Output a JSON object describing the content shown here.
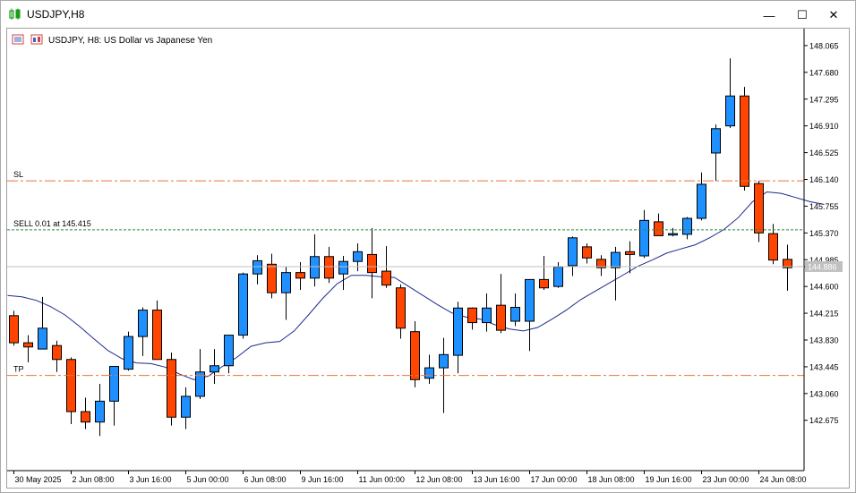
{
  "window": {
    "title": "USDJPY,H8"
  },
  "chart_header": {
    "text": "USDJPY, H8:  US Dollar vs Japanese Yen"
  },
  "window_buttons": {
    "minimize": "—",
    "maximize": "☐",
    "close": "✕"
  },
  "price_badge": "144.886",
  "trade_lines": {
    "sl": {
      "label": "SL",
      "price": 146.12,
      "color": "#e8743b"
    },
    "sell": {
      "label": "SELL 0.01 at 145.415",
      "price": 145.415,
      "color": "#2e8b3e"
    },
    "tp": {
      "label": "TP",
      "price": 143.32,
      "color": "#e8743b"
    }
  },
  "colors": {
    "bull": "#1e90ff",
    "bear": "#ff4500",
    "ma": "#1c2a8c",
    "bid_line": "#c0c0c0"
  },
  "chart_data": {
    "type": "candlestick",
    "symbol": "USDJPY",
    "timeframe": "H8",
    "ylim": [
      142.35,
      148.18
    ],
    "y_ticks": [
      "148.065",
      "147.680",
      "147.295",
      "146.910",
      "146.525",
      "146.140",
      "145.755",
      "145.370",
      "144.985",
      "144.600",
      "144.215",
      "143.830",
      "143.445",
      "143.060",
      "142.675"
    ],
    "x_ticks": [
      "30 May 2025",
      "2 Jun 08:00",
      "3 Jun 16:00",
      "5 Jun 00:00",
      "6 Jun 08:00",
      "9 Jun 16:00",
      "11 Jun 00:00",
      "12 Jun 08:00",
      "13 Jun 16:00",
      "17 Jun 00:00",
      "18 Jun 08:00",
      "19 Jun 16:00",
      "23 Jun 00:00",
      "24 Jun 08:00"
    ],
    "x_tick_index": [
      0,
      4,
      8,
      12,
      16,
      20,
      24,
      28,
      32,
      36,
      40,
      44,
      48,
      52
    ],
    "candles": [
      {
        "o": 144.18,
        "h": 144.25,
        "l": 143.75,
        "c": 143.79
      },
      {
        "o": 143.79,
        "h": 143.9,
        "l": 143.51,
        "c": 143.73
      },
      {
        "o": 143.7,
        "h": 144.45,
        "l": 143.7,
        "c": 144.0
      },
      {
        "o": 143.75,
        "h": 143.82,
        "l": 143.37,
        "c": 143.55
      },
      {
        "o": 143.55,
        "h": 143.58,
        "l": 142.62,
        "c": 142.8
      },
      {
        "o": 142.8,
        "h": 143.0,
        "l": 142.55,
        "c": 142.65
      },
      {
        "o": 142.65,
        "h": 143.2,
        "l": 142.45,
        "c": 142.95
      },
      {
        "o": 142.95,
        "h": 143.45,
        "l": 142.6,
        "c": 143.45
      },
      {
        "o": 143.41,
        "h": 143.95,
        "l": 143.39,
        "c": 143.88
      },
      {
        "o": 143.88,
        "h": 144.3,
        "l": 143.6,
        "c": 144.26
      },
      {
        "o": 144.26,
        "h": 144.4,
        "l": 143.64,
        "c": 143.55
      },
      {
        "o": 143.55,
        "h": 143.65,
        "l": 142.6,
        "c": 142.72
      },
      {
        "o": 142.72,
        "h": 143.15,
        "l": 142.55,
        "c": 143.02
      },
      {
        "o": 143.02,
        "h": 143.7,
        "l": 142.98,
        "c": 143.37
      },
      {
        "o": 143.37,
        "h": 143.7,
        "l": 143.2,
        "c": 143.46
      },
      {
        "o": 143.46,
        "h": 143.9,
        "l": 143.35,
        "c": 143.9
      },
      {
        "o": 143.9,
        "h": 144.8,
        "l": 143.85,
        "c": 144.78
      },
      {
        "o": 144.78,
        "h": 145.05,
        "l": 144.63,
        "c": 144.97
      },
      {
        "o": 144.92,
        "h": 145.07,
        "l": 144.43,
        "c": 144.51
      },
      {
        "o": 144.51,
        "h": 144.88,
        "l": 144.12,
        "c": 144.8
      },
      {
        "o": 144.8,
        "h": 144.95,
        "l": 144.55,
        "c": 144.72
      },
      {
        "o": 144.72,
        "h": 145.35,
        "l": 144.6,
        "c": 145.03
      },
      {
        "o": 145.03,
        "h": 145.17,
        "l": 144.65,
        "c": 144.72
      },
      {
        "o": 144.78,
        "h": 145.04,
        "l": 144.55,
        "c": 144.96
      },
      {
        "o": 144.96,
        "h": 145.22,
        "l": 144.82,
        "c": 145.1
      },
      {
        "o": 145.06,
        "h": 145.44,
        "l": 144.43,
        "c": 144.8
      },
      {
        "o": 144.82,
        "h": 145.18,
        "l": 144.58,
        "c": 144.62
      },
      {
        "o": 144.58,
        "h": 144.63,
        "l": 143.85,
        "c": 144.0
      },
      {
        "o": 143.95,
        "h": 144.1,
        "l": 143.15,
        "c": 143.26
      },
      {
        "o": 143.28,
        "h": 143.62,
        "l": 143.2,
        "c": 143.43
      },
      {
        "o": 143.43,
        "h": 143.86,
        "l": 142.78,
        "c": 143.62
      },
      {
        "o": 143.61,
        "h": 144.38,
        "l": 143.35,
        "c": 144.29
      },
      {
        "o": 144.29,
        "h": 144.3,
        "l": 143.98,
        "c": 144.08
      },
      {
        "o": 144.08,
        "h": 144.5,
        "l": 143.95,
        "c": 144.29
      },
      {
        "o": 144.33,
        "h": 144.78,
        "l": 143.93,
        "c": 143.97
      },
      {
        "o": 144.1,
        "h": 144.5,
        "l": 144.03,
        "c": 144.3
      },
      {
        "o": 144.1,
        "h": 144.7,
        "l": 143.67,
        "c": 144.7
      },
      {
        "o": 144.7,
        "h": 145.04,
        "l": 144.55,
        "c": 144.58
      },
      {
        "o": 144.6,
        "h": 144.95,
        "l": 144.58,
        "c": 144.88
      },
      {
        "o": 144.9,
        "h": 145.32,
        "l": 144.75,
        "c": 145.3
      },
      {
        "o": 145.17,
        "h": 145.22,
        "l": 144.93,
        "c": 145.01
      },
      {
        "o": 144.99,
        "h": 145.05,
        "l": 144.75,
        "c": 144.87
      },
      {
        "o": 144.87,
        "h": 145.17,
        "l": 144.4,
        "c": 145.09
      },
      {
        "o": 145.1,
        "h": 145.25,
        "l": 144.79,
        "c": 145.06
      },
      {
        "o": 145.04,
        "h": 145.7,
        "l": 145.01,
        "c": 145.55
      },
      {
        "o": 145.53,
        "h": 145.65,
        "l": 145.37,
        "c": 145.33
      },
      {
        "o": 145.34,
        "h": 145.44,
        "l": 145.32,
        "c": 145.36
      },
      {
        "o": 145.35,
        "h": 145.6,
        "l": 145.28,
        "c": 145.58
      },
      {
        "o": 145.58,
        "h": 146.24,
        "l": 145.55,
        "c": 146.07
      },
      {
        "o": 146.52,
        "h": 146.93,
        "l": 146.12,
        "c": 146.87
      },
      {
        "o": 146.91,
        "h": 147.88,
        "l": 146.88,
        "c": 147.34
      },
      {
        "o": 147.34,
        "h": 147.47,
        "l": 145.98,
        "c": 146.04
      },
      {
        "o": 146.08,
        "h": 146.12,
        "l": 145.24,
        "c": 145.37
      },
      {
        "o": 145.36,
        "h": 145.5,
        "l": 144.92,
        "c": 144.98
      },
      {
        "o": 144.99,
        "h": 145.2,
        "l": 144.54,
        "c": 144.87
      },
      {
        "o": 144.88,
        "h": 144.89,
        "l": 144.88,
        "c": 144.886
      }
    ],
    "ma": [
      144.47,
      144.45,
      144.4,
      144.31,
      144.19,
      144.03,
      143.85,
      143.68,
      143.56,
      143.5,
      143.49,
      143.44,
      143.34,
      143.26,
      143.31,
      143.45,
      143.58,
      143.74,
      143.79,
      143.81,
      143.96,
      144.19,
      144.43,
      144.64,
      144.76,
      144.76,
      144.74,
      144.73,
      144.6,
      144.47,
      144.34,
      144.22,
      144.16,
      144.13,
      144.05,
      143.99,
      143.96,
      144.01,
      144.13,
      144.26,
      144.41,
      144.53,
      144.65,
      144.77,
      144.89,
      144.98,
      145.08,
      145.14,
      145.2,
      145.3,
      145.42,
      145.59,
      145.82,
      145.96,
      145.94,
      145.88,
      145.82,
      145.78
    ]
  }
}
